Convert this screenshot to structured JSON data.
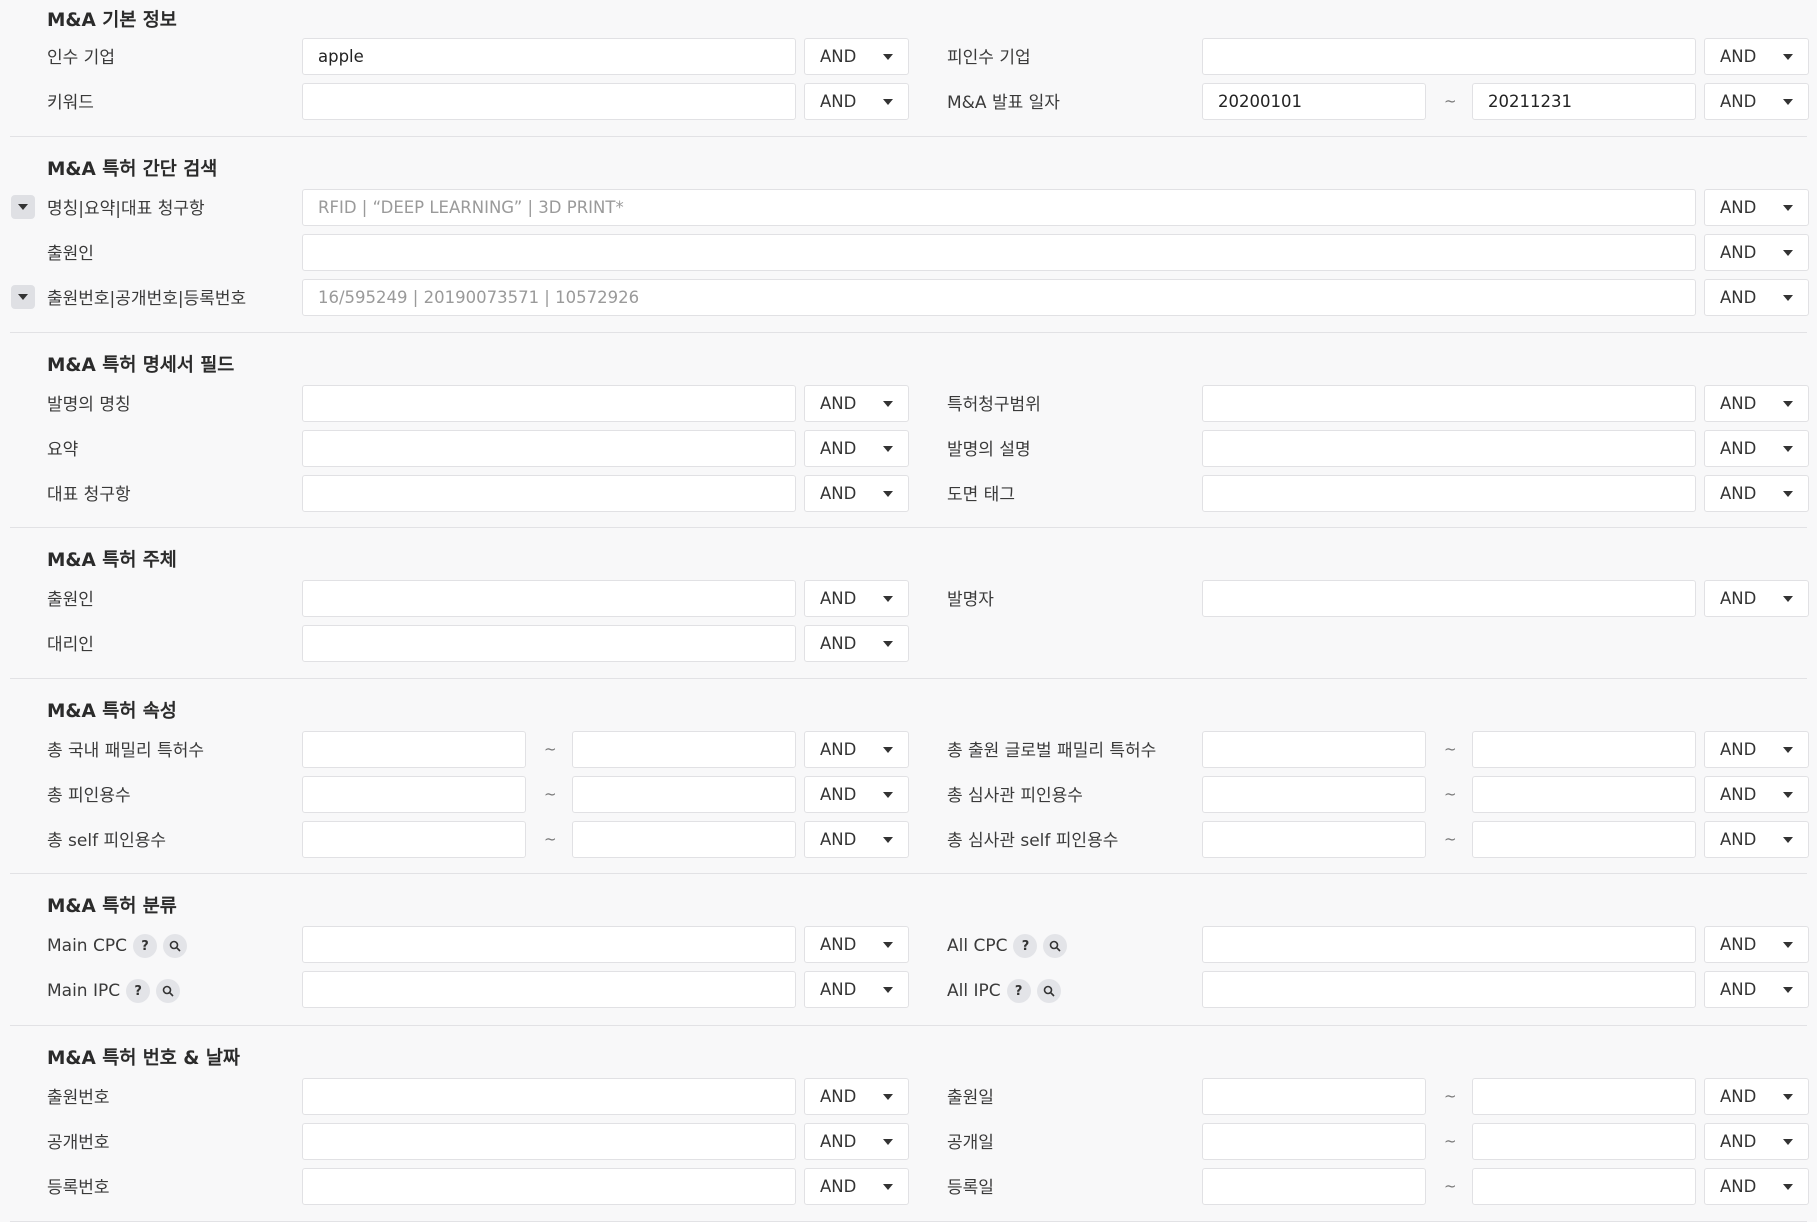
{
  "op_label": "AND",
  "tilde": "~",
  "icons": {
    "help": "question-mark-icon",
    "search": "magnifier-icon",
    "toggle": "triangle-down-icon"
  },
  "basic": {
    "title": "M&A 기본 정보",
    "acquirer_label": "인수 기업",
    "acquirer_value": "apple",
    "target_label": "피인수 기업",
    "target_value": "",
    "keyword_label": "키워드",
    "keyword_value": "",
    "date_label": "M&A 발표 일자",
    "date_from": "20200101",
    "date_to": "20211231"
  },
  "quick": {
    "title": "M&A 특허 간단 검색",
    "title_claims_label": "명칭|요약|대표 청구항",
    "title_claims_placeholder": "RFID | “DEEP LEARNING” | 3D PRINT*",
    "applicant_label": "출원인",
    "numbers_label": "출원번호|공개번호|등록번호",
    "numbers_placeholder": "16/595249 | 20190073571 | 10572926"
  },
  "spec": {
    "title": "M&A 특허 명세서 필드",
    "invention_title_label": "발명의 명칭",
    "claims_scope_label": "특허청구범위",
    "abstract_label": "요약",
    "description_label": "발명의 설명",
    "rep_claim_label": "대표 청구항",
    "drawing_tag_label": "도면 태그"
  },
  "entity": {
    "title": "M&A 특허 주체",
    "applicant_label": "출원인",
    "inventor_label": "발명자",
    "agent_label": "대리인"
  },
  "attrs": {
    "title": "M&A 특허 속성",
    "domestic_family_label": "총 국내 패밀리 특허수",
    "global_family_label": "총 출원 글로벌 패밀리 특허수",
    "citations_label": "총 피인용수",
    "examiner_citations_label": "총 심사관 피인용수",
    "self_citations_label": "총 self 피인용수",
    "examiner_self_citations_label": "총 심사관 self 피인용수"
  },
  "classif": {
    "title": "M&A 특허 분류",
    "main_cpc_label": "Main CPC",
    "all_cpc_label": "All CPC",
    "main_ipc_label": "Main IPC",
    "all_ipc_label": "All IPC",
    "help_glyph": "?"
  },
  "numdate": {
    "title": "M&A 특허 번호 & 날짜",
    "app_no_label": "출원번호",
    "app_date_label": "출원일",
    "pub_no_label": "공개번호",
    "pub_date_label": "공개일",
    "reg_no_label": "등록번호",
    "reg_date_label": "등록일"
  }
}
